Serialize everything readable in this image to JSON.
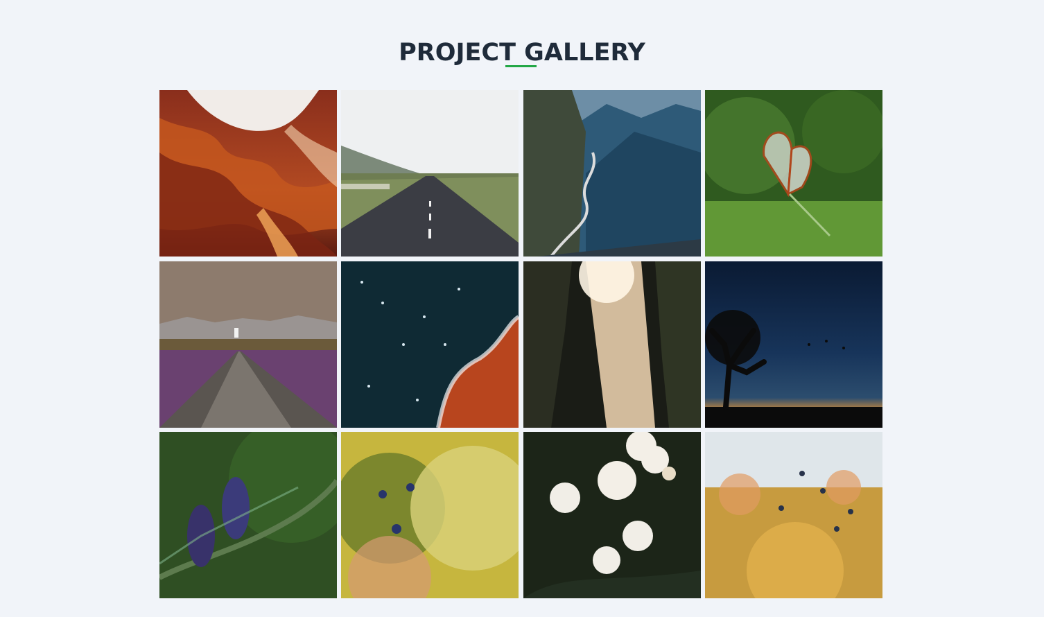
{
  "header": {
    "title": "PROJECT GALLERY",
    "accent_color": "#22a745"
  },
  "gallery": {
    "items": [
      {
        "name": "canyon-photo"
      },
      {
        "name": "road-photo"
      },
      {
        "name": "mountain-pass-photo"
      },
      {
        "name": "butterfly-photo"
      },
      {
        "name": "lavender-road-photo"
      },
      {
        "name": "aerial-coast-photo"
      },
      {
        "name": "forest-sunbeam-photo"
      },
      {
        "name": "tree-sunset-photo"
      },
      {
        "name": "pine-cones-photo"
      },
      {
        "name": "blueberry-bush-photo"
      },
      {
        "name": "white-roses-photo"
      },
      {
        "name": "berry-shrubs-photo"
      }
    ]
  }
}
